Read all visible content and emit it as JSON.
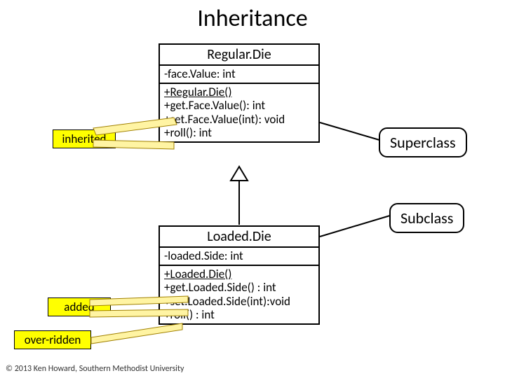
{
  "title": "Inheritance",
  "superclass": {
    "name": "Regular.Die",
    "attributes": [
      "-face.Value: int"
    ],
    "operations": [
      "+Regular.Die()",
      "+get.Face.Value(): int",
      "+set.Face.Value(int): void",
      "+roll(): int"
    ]
  },
  "subclass": {
    "name": "Loaded.Die",
    "attributes": [
      "-loaded.Side: int"
    ],
    "operations": [
      "+Loaded.Die()",
      "+get.Loaded.Side() : int",
      "+set.Loaded.Side(int):void",
      "+roll() : int"
    ]
  },
  "labels": {
    "inherited": "inherited",
    "added": "added",
    "overridden": "over-ridden",
    "superclass": "Superclass",
    "subclass": "Subclass"
  },
  "footer": "© 2013 Ken Howard, Southern Methodist University"
}
